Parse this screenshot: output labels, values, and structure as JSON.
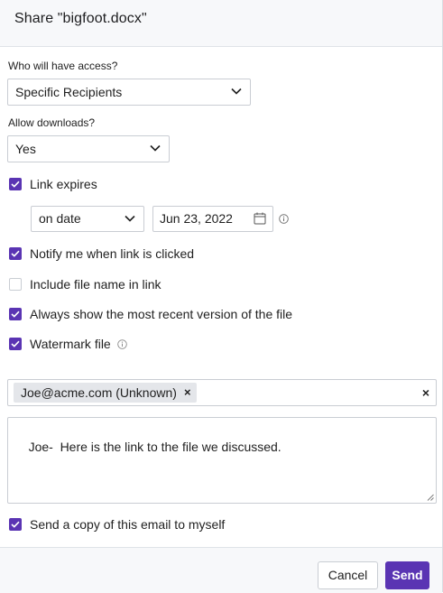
{
  "dialog": {
    "title": "Share \"bigfoot.docx\""
  },
  "access": {
    "label": "Who will have access?",
    "selected": "Specific Recipients"
  },
  "downloads": {
    "label": "Allow downloads?",
    "selected": "Yes"
  },
  "link_expires": {
    "label": "Link expires",
    "checked": true,
    "mode": "on date",
    "date": "Jun 23, 2022"
  },
  "options": [
    {
      "label": "Notify me when link is clicked",
      "checked": true
    },
    {
      "label": "Include file name in link",
      "checked": false
    },
    {
      "label": "Always show the most recent version of the file",
      "checked": true
    },
    {
      "label": "Watermark file",
      "checked": true
    }
  ],
  "recipients": {
    "chips": [
      "Joe@acme.com (Unknown)"
    ],
    "chip_remove_glyph": "×",
    "clear_glyph": "×"
  },
  "message": {
    "value": "Joe-  Here is the link to the file we discussed."
  },
  "send_copy": {
    "label": "Send a copy of this email to myself",
    "checked": true
  },
  "footer": {
    "cancel_label": "Cancel",
    "send_label": "Send"
  },
  "colors": {
    "accent": "#5a34b3",
    "border": "#c9cdd3",
    "header_bg": "#f7f8fa"
  },
  "icons": {
    "chevron": "chevron-down-icon",
    "calendar": "calendar-icon",
    "info": "info-icon",
    "check": "check-icon",
    "remove": "close-icon",
    "resize": "resize-handle-icon"
  }
}
